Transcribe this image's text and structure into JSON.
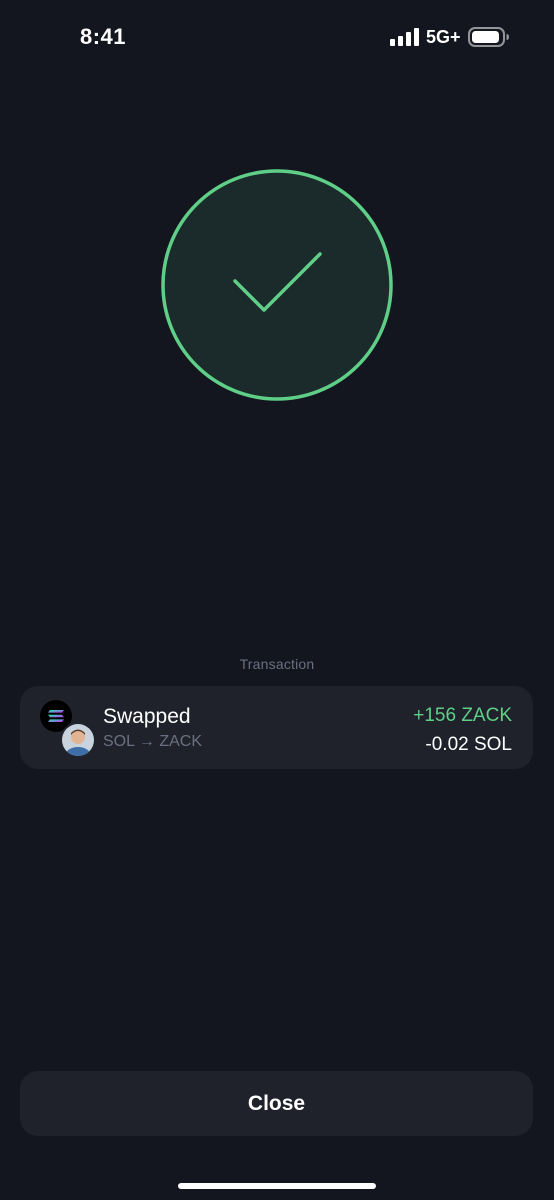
{
  "status_bar": {
    "time": "8:41",
    "network": "5G+",
    "icons": [
      "signal-bars-icon",
      "battery-icon"
    ]
  },
  "success": {
    "icon": "checkmark-circle-icon",
    "accent_color": "#5fcf88"
  },
  "transaction": {
    "section_label": "Transaction",
    "title": "Swapped",
    "subtitle": "SOL → ZACK",
    "amount_received": "+156 ZACK",
    "amount_sent": "-0.02 SOL",
    "icons": [
      "solana-logo-icon",
      "zack-avatar"
    ]
  },
  "actions": {
    "close_label": "Close"
  },
  "colors": {
    "background": "#13161e",
    "card": "#1f222b",
    "positive": "#5fcf88",
    "muted_text": "#6b7080"
  }
}
